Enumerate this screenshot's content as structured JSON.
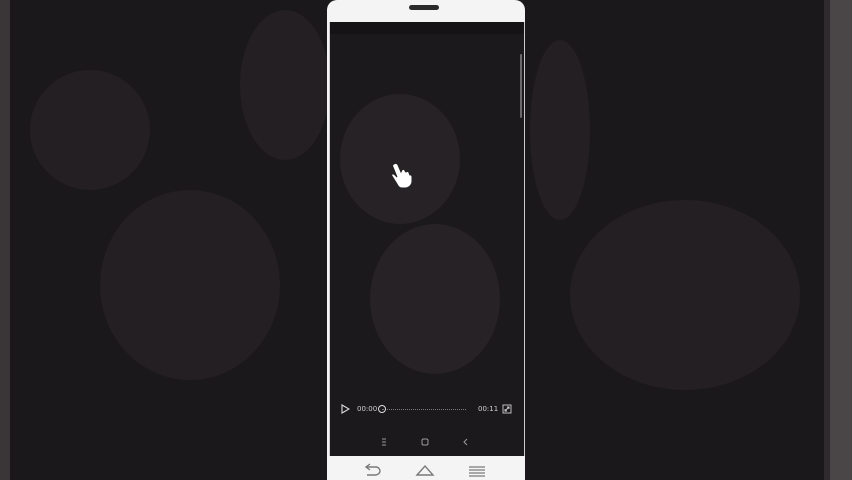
{
  "video_player": {
    "current_time": "00:00",
    "duration": "00:11",
    "progress": 0.0
  },
  "icons": {
    "play": "play-icon",
    "fullscreen": "fullscreen-icon",
    "cursor": "hand-pointer-icon",
    "soft_menu": "menu-icon",
    "soft_home": "home-icon",
    "soft_back": "back-icon",
    "hw_back": "back-arrow-icon",
    "hw_home": "home-icon",
    "hw_menu": "menu-lines-icon"
  },
  "colors": {
    "background": "#1b181c",
    "phone_body": "#f4f4f4",
    "screen": "#1c191c",
    "control_text": "#cfcfcf"
  }
}
